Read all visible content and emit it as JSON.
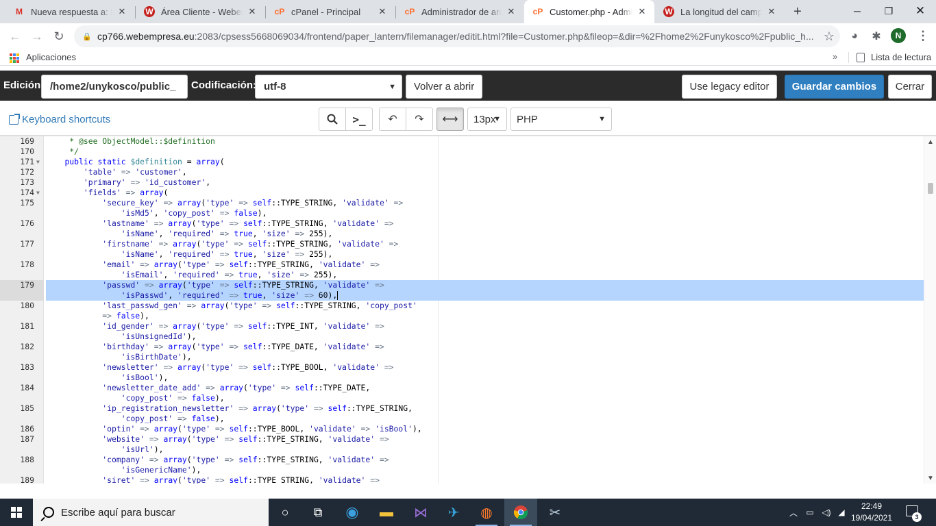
{
  "browser": {
    "tabs": [
      {
        "label": "Nueva respuesta a: La longitud",
        "icon": "gmail-icon",
        "active": false
      },
      {
        "label": "Área Cliente - Webempresa",
        "icon": "webempresa-icon",
        "active": false
      },
      {
        "label": "cPanel - Principal",
        "icon": "cpanel-icon",
        "active": false
      },
      {
        "label": "Administrador de archivos",
        "icon": "cpanel-icon",
        "active": false
      },
      {
        "label": "Customer.php - Administrador",
        "icon": "cpanel-icon",
        "active": true
      },
      {
        "label": "La longitud del campo Contraseña",
        "icon": "webempresa-icon",
        "active": false
      }
    ],
    "url_host": "cp766.webempresa.eu",
    "url_rest": ":2083/cpsess5668069034/frontend/paper_lantern/filemanager/editit.html?file=Customer.php&fileop=&dir=%2Fhome2%2Funykosco%2Fpublic_h...",
    "avatar_letter": "N",
    "bookmarks": {
      "apps_label": "Aplicaciones",
      "reading_list_label": "Lista de lectura",
      "more": "»"
    }
  },
  "cpanel": {
    "edition_label": "Edición:",
    "path_value": "/home2/unykosco/public_",
    "encoding_label": "Codificación:",
    "encoding_value": "utf-8",
    "reopen_button": "Volver a abrir",
    "legacy_button": "Use legacy editor",
    "save_button": "Guardar cambios",
    "close_button": "Cerrar"
  },
  "editor_toolbar": {
    "shortcuts_link": "Keyboard shortcuts",
    "font_size": "13px",
    "language": "PHP"
  },
  "code_lines": [
    {
      "n": "169",
      "c": "     * @see ObjectModel::$definition"
    },
    {
      "n": "170",
      "c": "     */"
    },
    {
      "n": "171",
      "c": "    public static $definition = array(",
      "fold": true
    },
    {
      "n": "172",
      "c": "        'table' => 'customer',"
    },
    {
      "n": "173",
      "c": "        'primary' => 'id_customer',"
    },
    {
      "n": "174",
      "c": "        'fields' => array(",
      "fold": true
    },
    {
      "n": "175",
      "c": "            'secure_key' => array('type' => self::TYPE_STRING, 'validate' =>"
    },
    {
      "n": "",
      "c": "                'isMd5', 'copy_post' => false),"
    },
    {
      "n": "176",
      "c": "            'lastname' => array('type' => self::TYPE_STRING, 'validate' =>"
    },
    {
      "n": "",
      "c": "                'isName', 'required' => true, 'size' => 255),"
    },
    {
      "n": "177",
      "c": "            'firstname' => array('type' => self::TYPE_STRING, 'validate' =>"
    },
    {
      "n": "",
      "c": "                'isName', 'required' => true, 'size' => 255),"
    },
    {
      "n": "178",
      "c": "            'email' => array('type' => self::TYPE_STRING, 'validate' =>"
    },
    {
      "n": "",
      "c": "                'isEmail', 'required' => true, 'size' => 255),"
    },
    {
      "n": "179",
      "c": "            'passwd' => array('type' => self::TYPE_STRING, 'validate' =>",
      "sel": true
    },
    {
      "n": "",
      "c": "                'isPasswd', 'required' => true, 'size' => 60),",
      "sel": true,
      "cursor": true
    },
    {
      "n": "180",
      "c": "            'last_passwd_gen' => array('type' => self::TYPE_STRING, 'copy_post'"
    },
    {
      "n": "",
      "c": "            => false),"
    },
    {
      "n": "181",
      "c": "            'id_gender' => array('type' => self::TYPE_INT, 'validate' =>"
    },
    {
      "n": "",
      "c": "                'isUnsignedId'),"
    },
    {
      "n": "182",
      "c": "            'birthday' => array('type' => self::TYPE_DATE, 'validate' =>"
    },
    {
      "n": "",
      "c": "                'isBirthDate'),"
    },
    {
      "n": "183",
      "c": "            'newsletter' => array('type' => self::TYPE_BOOL, 'validate' =>"
    },
    {
      "n": "",
      "c": "                'isBool'),"
    },
    {
      "n": "184",
      "c": "            'newsletter_date_add' => array('type' => self::TYPE_DATE,"
    },
    {
      "n": "",
      "c": "                'copy_post' => false),"
    },
    {
      "n": "185",
      "c": "            'ip_registration_newsletter' => array('type' => self::TYPE_STRING,"
    },
    {
      "n": "",
      "c": "                'copy_post' => false),"
    },
    {
      "n": "186",
      "c": "            'optin' => array('type' => self::TYPE_BOOL, 'validate' => 'isBool'),"
    },
    {
      "n": "187",
      "c": "            'website' => array('type' => self::TYPE_STRING, 'validate' =>"
    },
    {
      "n": "",
      "c": "                'isUrl'),"
    },
    {
      "n": "188",
      "c": "            'company' => array('type' => self::TYPE_STRING, 'validate' =>"
    },
    {
      "n": "",
      "c": "                'isGenericName'),"
    },
    {
      "n": "189",
      "c": "            'siret' => array('type' => self::TYPE_STRING, 'validate' =>"
    }
  ],
  "taskbar": {
    "search_placeholder": "Escribe aquí para buscar",
    "time": "22:49",
    "date": "19/04/2021",
    "notification_count": "3"
  },
  "colors": {
    "cpanel_header": "#2b2b2b",
    "primary_button": "#2f7fc1",
    "selection": "#b5d5ff",
    "link": "#337ab7"
  }
}
